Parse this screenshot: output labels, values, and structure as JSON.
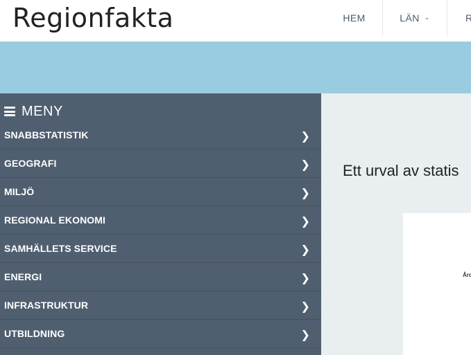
{
  "header": {
    "logo": "Regionfakta",
    "nav": [
      {
        "label": "HEM"
      },
      {
        "label": "LÄN",
        "has_dropdown": true
      },
      {
        "label": "R"
      }
    ]
  },
  "sidebar": {
    "menu_title": "MENY",
    "items": [
      {
        "label": "SNABBSTATISTIK"
      },
      {
        "label": "GEOGRAFI"
      },
      {
        "label": "MILJÖ"
      },
      {
        "label": "REGIONAL EKONOMI"
      },
      {
        "label": "SAMHÄLLETS SERVICE"
      },
      {
        "label": "ENERGI"
      },
      {
        "label": "INFRASTRUKTUR"
      },
      {
        "label": "UTBILDNING"
      }
    ]
  },
  "main": {
    "intro_text": "Ett urval av statis",
    "card_label": "Årc"
  },
  "icons": {
    "menu": "hamburger-icon",
    "item_arrow": "chevron-right-icon",
    "dropdown": "chevron-down-icon"
  },
  "colors": {
    "banner": "#99cce0",
    "sidebar": "#4f5f70",
    "content_bg": "#e9eef1"
  }
}
